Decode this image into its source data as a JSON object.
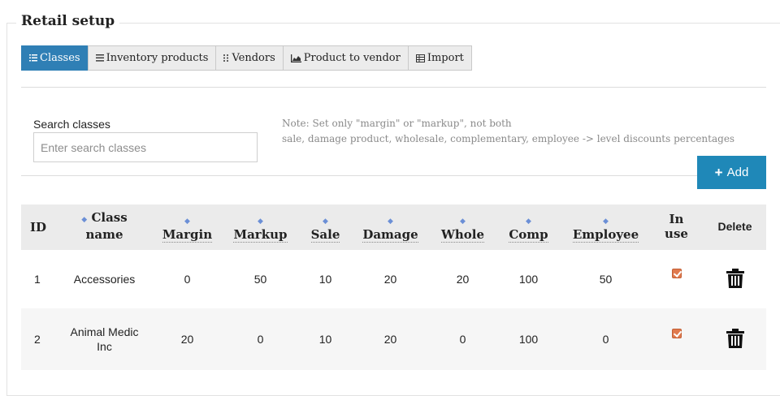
{
  "page": {
    "title": "Retail setup"
  },
  "tabs": [
    {
      "label": "Classes",
      "icon": "list-icon",
      "active": true
    },
    {
      "label": "Inventory products",
      "icon": "list-icon"
    },
    {
      "label": "Vendors",
      "icon": "grip-icon"
    },
    {
      "label": "Product to vendor",
      "icon": "area-chart-icon"
    },
    {
      "label": "Import",
      "icon": "table-icon"
    }
  ],
  "search": {
    "label": "Search classes",
    "placeholder": "Enter search classes",
    "value": ""
  },
  "note": {
    "line1": "Note: Set only \"margin\" or \"markup\", not both",
    "line2": "sale, damage product, wholesale, complementary, employee -> level discounts percentages"
  },
  "add_button": {
    "label": "Add",
    "icon": "plus-icon"
  },
  "table": {
    "headers": {
      "id": "ID",
      "class_name_1": "Class",
      "class_name_2": "name",
      "margin": "Margin",
      "markup": "Markup",
      "sale": "Sale",
      "damage": "Damage",
      "whole": "Whole",
      "comp": "Comp",
      "employee": "Employee",
      "in_use_1": "In",
      "in_use_2": "use",
      "delete": "Delete"
    },
    "rows": [
      {
        "id": "1",
        "class_name": "Accessories",
        "margin": "0",
        "markup": "50",
        "sale": "10",
        "damage": "20",
        "whole": "20",
        "comp": "100",
        "employee": "50",
        "in_use": true
      },
      {
        "id": "2",
        "class_name_1": "Animal Medic",
        "class_name_2": "Inc",
        "margin": "20",
        "markup": "0",
        "sale": "10",
        "damage": "20",
        "whole": "0",
        "comp": "100",
        "employee": "0",
        "in_use": true
      }
    ]
  },
  "colors": {
    "accent": "#2f7fb5",
    "add_button": "#1f88b8",
    "checkbox": "#e07a4e",
    "header_bg": "#ebebeb"
  }
}
